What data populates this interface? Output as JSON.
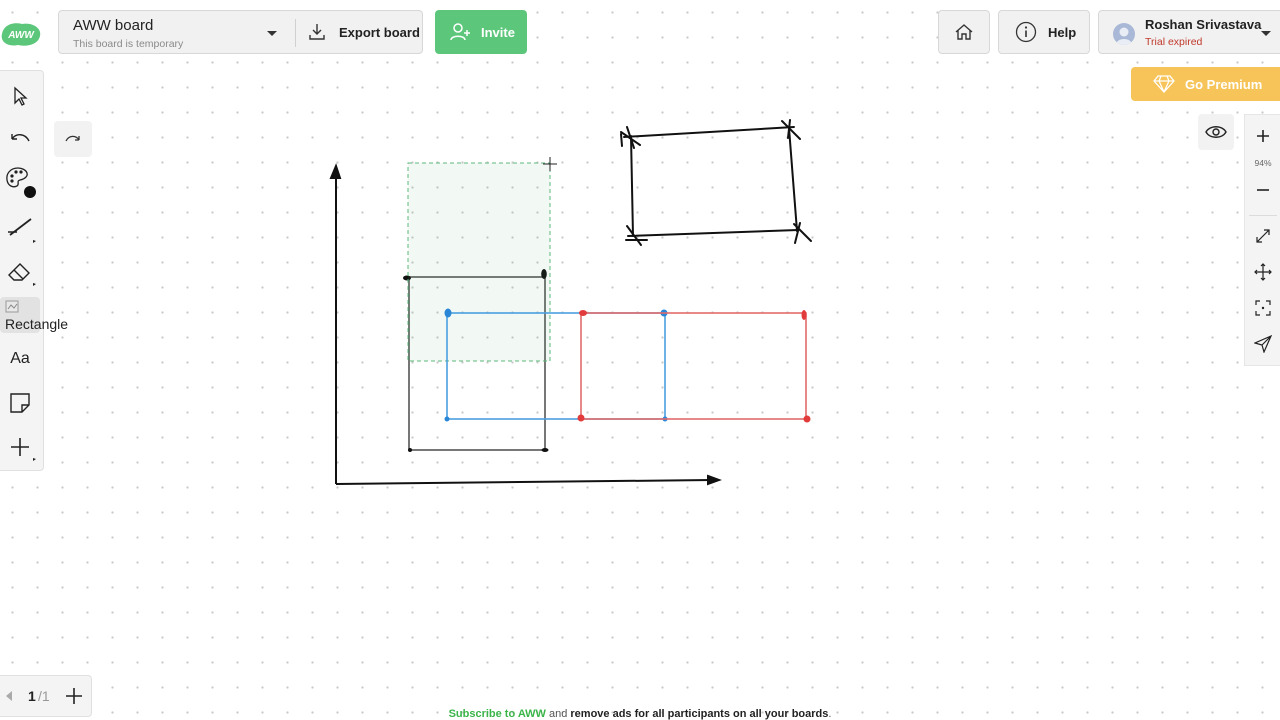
{
  "app": {
    "logo_text": "AWW"
  },
  "board": {
    "title": "AWW board",
    "subtitle": "This board is temporary",
    "export_label": "Export board"
  },
  "invite": {
    "label": "Invite"
  },
  "header": {
    "help_label": "Help",
    "user_name": "Roshan Srivastava",
    "user_status": "Trial expired"
  },
  "premium": {
    "label": "Go Premium"
  },
  "toolbar": {
    "items": [
      {
        "name": "select",
        "icon": "pointer-icon"
      },
      {
        "name": "undo",
        "icon": "undo-icon"
      },
      {
        "name": "color",
        "icon": "palette-icon"
      },
      {
        "name": "line",
        "icon": "line-icon"
      },
      {
        "name": "eraser",
        "icon": "eraser-icon"
      },
      {
        "name": "rectangle",
        "icon": "rectangle-icon"
      },
      {
        "name": "text",
        "icon": "text-icon"
      },
      {
        "name": "sticky",
        "icon": "sticky-note-icon"
      },
      {
        "name": "more",
        "icon": "plus-icon"
      }
    ],
    "rectangle_label": "Rectangle",
    "text_label": "Aa",
    "redo_icon": "redo-icon"
  },
  "zoom": {
    "level": "94%"
  },
  "pagination": {
    "current": "1",
    "total": "/1"
  },
  "footer": {
    "link_text": "Subscribe to AWW",
    "middle_text": " and ",
    "bold_text": "remove ads for all participants on all your boards",
    "end_text": "."
  },
  "colors": {
    "accent_green": "#5cc77b",
    "premium": "#f6c459",
    "shape_blue": "#4a9fe0",
    "shape_red": "#e23b3b",
    "selection_green": "#5cb87a"
  }
}
